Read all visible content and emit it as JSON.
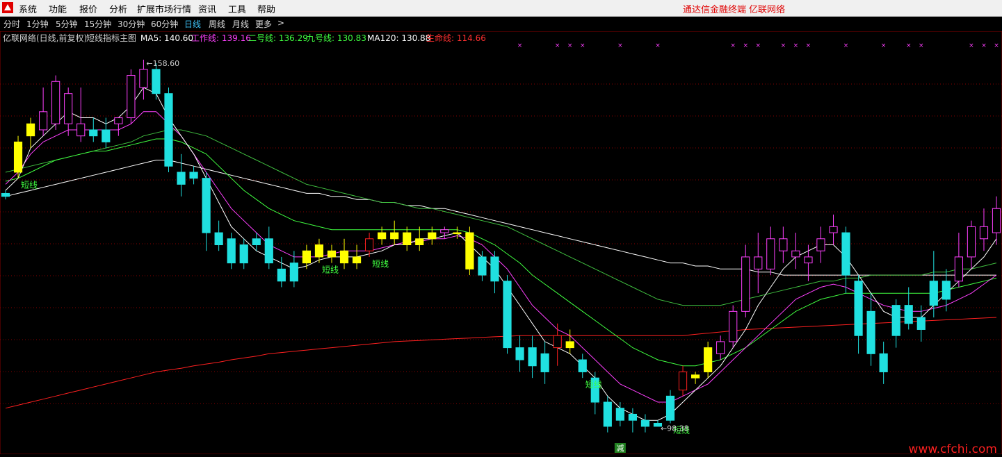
{
  "menu": {
    "items": [
      "系统",
      "功能",
      "报价",
      "分析",
      "扩展市场行情",
      "资讯",
      "工具",
      "帮助"
    ],
    "brand_left": "通达信金融终端",
    "brand_right": "亿联网络"
  },
  "periods": {
    "items": [
      "分时",
      "1分钟",
      "5分钟",
      "15分钟",
      "30分钟",
      "60分钟",
      "日线",
      "周线",
      "月线",
      "更多"
    ],
    "active": "日线",
    "more_arrow": ">"
  },
  "legend": {
    "prefix": "亿联网络(日线,前复权)",
    "indicator": "短线指标主图",
    "entries": [
      {
        "label": "MA5: 140.60",
        "color": "#ffffff"
      },
      {
        "label": "工作线: 139.16",
        "color": "#ff40ff"
      },
      {
        "label": "二号线: 136.29",
        "color": "#40ff40"
      },
      {
        "label": "九号线: 130.83",
        "color": "#40ff40"
      },
      {
        "label": "MA120: 130.88",
        "color": "#ffffff"
      },
      {
        "label": "生命线: 114.66",
        "color": "#ff3030"
      }
    ]
  },
  "colors": {
    "up": "#ff40ff",
    "down": "#20e0e0",
    "signal": "#ffff00",
    "signal_up": "#ff2020",
    "ma5": "#ffffff",
    "work": "#ff40ff",
    "line2": "#40ff40",
    "line9": "#40c040",
    "ma120": "#ffffff",
    "life": "#ff2020",
    "grid": "#8a0000",
    "label_green": "#40ff40",
    "extreme_label": "#d0d0d0",
    "marker": "#ff40ff",
    "jian_bg": "#208020",
    "jian_text": "#ffffff"
  },
  "chart_data": {
    "type": "candlestick",
    "y_range": [
      95,
      161
    ],
    "extremes": {
      "high": {
        "value": 158.6,
        "label": "158.60",
        "index": 11
      },
      "low": {
        "value": 98.38,
        "label": "98.38",
        "index": 52
      }
    },
    "signal_label": "短线",
    "signal_label_indices": [
      1,
      25,
      29,
      46,
      53
    ],
    "jian_label": "减",
    "jian_index": 49,
    "candles": [
      {
        "o": 136,
        "h": 137,
        "l": 135.5,
        "c": 136.5,
        "k": "d"
      },
      {
        "o": 140,
        "h": 146,
        "l": 139,
        "c": 145,
        "k": "s"
      },
      {
        "o": 146,
        "h": 149,
        "l": 144,
        "c": 148,
        "k": "s"
      },
      {
        "o": 150,
        "h": 154,
        "l": 146,
        "c": 147,
        "k": "u"
      },
      {
        "o": 148,
        "h": 156,
        "l": 147,
        "c": 155,
        "k": "u"
      },
      {
        "o": 153,
        "h": 154,
        "l": 146,
        "c": 148,
        "k": "u"
      },
      {
        "o": 148,
        "h": 154,
        "l": 145,
        "c": 146,
        "k": "u"
      },
      {
        "o": 147,
        "h": 149,
        "l": 145,
        "c": 146,
        "k": "d"
      },
      {
        "o": 145,
        "h": 149,
        "l": 144,
        "c": 147,
        "k": "d"
      },
      {
        "o": 148,
        "h": 149,
        "l": 146,
        "c": 149,
        "k": "u"
      },
      {
        "o": 149,
        "h": 157,
        "l": 148,
        "c": 156,
        "k": "u"
      },
      {
        "o": 154,
        "h": 158.6,
        "l": 152,
        "c": 157,
        "k": "u"
      },
      {
        "o": 157,
        "h": 158,
        "l": 152,
        "c": 153,
        "k": "d"
      },
      {
        "o": 153,
        "h": 154,
        "l": 140,
        "c": 141,
        "k": "d"
      },
      {
        "o": 140,
        "h": 143,
        "l": 136,
        "c": 138,
        "k": "d"
      },
      {
        "o": 140,
        "h": 141,
        "l": 138,
        "c": 139,
        "k": "d"
      },
      {
        "o": 139,
        "h": 140,
        "l": 127,
        "c": 130,
        "k": "d"
      },
      {
        "o": 130,
        "h": 132,
        "l": 127,
        "c": 128,
        "k": "d"
      },
      {
        "o": 129,
        "h": 130,
        "l": 124,
        "c": 125,
        "k": "d"
      },
      {
        "o": 125,
        "h": 129,
        "l": 124,
        "c": 128,
        "k": "d"
      },
      {
        "o": 128,
        "h": 130,
        "l": 127,
        "c": 129,
        "k": "d"
      },
      {
        "o": 129,
        "h": 131,
        "l": 124,
        "c": 125,
        "k": "d"
      },
      {
        "o": 124,
        "h": 126,
        "l": 121,
        "c": 122,
        "k": "d"
      },
      {
        "o": 122,
        "h": 127,
        "l": 121,
        "c": 125,
        "k": "d"
      },
      {
        "o": 125,
        "h": 128,
        "l": 124,
        "c": 127,
        "k": "s"
      },
      {
        "o": 128,
        "h": 129,
        "l": 125,
        "c": 126,
        "k": "s"
      },
      {
        "o": 127,
        "h": 128,
        "l": 125,
        "c": 126,
        "k": "s"
      },
      {
        "o": 127,
        "h": 129,
        "l": 124,
        "c": 125,
        "k": "s"
      },
      {
        "o": 125,
        "h": 128,
        "l": 124,
        "c": 126,
        "k": "s"
      },
      {
        "o": 129,
        "h": 130,
        "l": 126,
        "c": 127,
        "k": "r"
      },
      {
        "o": 129,
        "h": 131,
        "l": 128,
        "c": 130,
        "k": "s"
      },
      {
        "o": 130,
        "h": 132,
        "l": 128,
        "c": 129,
        "k": "s"
      },
      {
        "o": 130,
        "h": 131,
        "l": 127,
        "c": 128,
        "k": "s"
      },
      {
        "o": 129,
        "h": 131,
        "l": 127,
        "c": 128,
        "k": "s"
      },
      {
        "o": 130,
        "h": 131,
        "l": 128,
        "c": 129,
        "k": "s"
      },
      {
        "o": 130,
        "h": 131,
        "l": 129,
        "c": 130.5,
        "k": "u"
      },
      {
        "o": 130,
        "h": 131,
        "l": 129,
        "c": 130,
        "k": "s"
      },
      {
        "o": 130,
        "h": 131,
        "l": 123,
        "c": 124,
        "k": "s"
      },
      {
        "o": 126,
        "h": 127,
        "l": 122,
        "c": 123,
        "k": "d"
      },
      {
        "o": 126,
        "h": 127,
        "l": 120,
        "c": 122,
        "k": "d"
      },
      {
        "o": 122,
        "h": 123,
        "l": 110,
        "c": 111,
        "k": "d"
      },
      {
        "o": 111,
        "h": 113,
        "l": 107,
        "c": 109,
        "k": "d"
      },
      {
        "o": 111,
        "h": 113,
        "l": 106,
        "c": 108,
        "k": "d"
      },
      {
        "o": 110,
        "h": 112,
        "l": 105,
        "c": 107,
        "k": "d"
      },
      {
        "o": 111,
        "h": 115,
        "l": 108,
        "c": 113,
        "k": "r"
      },
      {
        "o": 111,
        "h": 114,
        "l": 110,
        "c": 112,
        "k": "s"
      },
      {
        "o": 109,
        "h": 110,
        "l": 106,
        "c": 107,
        "k": "d"
      },
      {
        "o": 106,
        "h": 107,
        "l": 100,
        "c": 102,
        "k": "d"
      },
      {
        "o": 102,
        "h": 103,
        "l": 97,
        "c": 98,
        "k": "d"
      },
      {
        "o": 101,
        "h": 102,
        "l": 98,
        "c": 99,
        "k": "d"
      },
      {
        "o": 100,
        "h": 101,
        "l": 97,
        "c": 99,
        "k": "d"
      },
      {
        "o": 99,
        "h": 100,
        "l": 97,
        "c": 98,
        "k": "d"
      },
      {
        "o": 98,
        "h": 99,
        "l": 98.38,
        "c": 98.5,
        "k": "d"
      },
      {
        "o": 99,
        "h": 104,
        "l": 98.5,
        "c": 103,
        "k": "d"
      },
      {
        "o": 104,
        "h": 108,
        "l": 103,
        "c": 107,
        "k": "r"
      },
      {
        "o": 106,
        "h": 107,
        "l": 105,
        "c": 106.5,
        "k": "s"
      },
      {
        "o": 107,
        "h": 112,
        "l": 106,
        "c": 111,
        "k": "s"
      },
      {
        "o": 110,
        "h": 113,
        "l": 109,
        "c": 112,
        "k": "u"
      },
      {
        "o": 112,
        "h": 118,
        "l": 111,
        "c": 117,
        "k": "u"
      },
      {
        "o": 117,
        "h": 128,
        "l": 116,
        "c": 126,
        "k": "u"
      },
      {
        "o": 126,
        "h": 130,
        "l": 120,
        "c": 124,
        "k": "u"
      },
      {
        "o": 124,
        "h": 131,
        "l": 123,
        "c": 129,
        "k": "u"
      },
      {
        "o": 129,
        "h": 131,
        "l": 125,
        "c": 127,
        "k": "u"
      },
      {
        "o": 127,
        "h": 130,
        "l": 124,
        "c": 126,
        "k": "u"
      },
      {
        "o": 126,
        "h": 128,
        "l": 122,
        "c": 125,
        "k": "u"
      },
      {
        "o": 127,
        "h": 131,
        "l": 125,
        "c": 129,
        "k": "u"
      },
      {
        "o": 130,
        "h": 133,
        "l": 128,
        "c": 131,
        "k": "u"
      },
      {
        "o": 130,
        "h": 131,
        "l": 120,
        "c": 123,
        "k": "d"
      },
      {
        "o": 122,
        "h": 123,
        "l": 110,
        "c": 113,
        "k": "d"
      },
      {
        "o": 117,
        "h": 120,
        "l": 108,
        "c": 110,
        "k": "d"
      },
      {
        "o": 110,
        "h": 112,
        "l": 105,
        "c": 107,
        "k": "d"
      },
      {
        "o": 113,
        "h": 119,
        "l": 111,
        "c": 118,
        "k": "d"
      },
      {
        "o": 118,
        "h": 121,
        "l": 114,
        "c": 115,
        "k": "d"
      },
      {
        "o": 116,
        "h": 118,
        "l": 112,
        "c": 114,
        "k": "d"
      },
      {
        "o": 118,
        "h": 127,
        "l": 116,
        "c": 122,
        "k": "d"
      },
      {
        "o": 122,
        "h": 124,
        "l": 117,
        "c": 119,
        "k": "d"
      },
      {
        "o": 122,
        "h": 130,
        "l": 121,
        "c": 126,
        "k": "u"
      },
      {
        "o": 126,
        "h": 132,
        "l": 124,
        "c": 131,
        "k": "u"
      },
      {
        "o": 131,
        "h": 134,
        "l": 127,
        "c": 129,
        "k": "u"
      },
      {
        "o": 130,
        "h": 136,
        "l": 128,
        "c": 134,
        "k": "u"
      }
    ],
    "lines": {
      "ma5": [
        137,
        139,
        144,
        146,
        148,
        150,
        149,
        149,
        148,
        149,
        151,
        154,
        153,
        149,
        146,
        143,
        139,
        135,
        131,
        129,
        127,
        126,
        125,
        124,
        124.5,
        125.5,
        126,
        126,
        126,
        126.5,
        127,
        128,
        128,
        129,
        129,
        129.5,
        130,
        128,
        126,
        124,
        121,
        118,
        115,
        112,
        111,
        110,
        108,
        106,
        103,
        101,
        100,
        99,
        99,
        100,
        102,
        104,
        106,
        108,
        111,
        114,
        118,
        121,
        124,
        126,
        127,
        128,
        128,
        126,
        123,
        120,
        117,
        116,
        116,
        116,
        118,
        120,
        122,
        124,
        126,
        129
      ],
      "work": [
        138,
        140,
        143,
        145,
        146,
        147,
        147,
        147,
        147,
        147,
        148,
        150,
        150,
        148,
        146,
        143,
        140,
        137,
        134,
        132,
        130,
        128,
        127,
        126,
        126,
        126,
        126.5,
        127,
        127,
        127,
        127.5,
        128,
        128.5,
        128.5,
        129,
        129,
        129.5,
        129,
        128,
        126,
        124,
        121,
        118,
        116,
        114,
        113,
        111,
        109,
        107,
        105,
        104,
        103,
        102,
        102,
        103,
        104,
        105,
        107,
        109,
        111,
        113,
        115,
        117,
        119,
        120,
        121,
        121.5,
        121,
        120,
        119,
        118,
        117.5,
        117,
        117,
        117.5,
        118,
        119,
        120,
        121.5,
        123
      ],
      "line2": [
        138.5,
        139,
        140,
        141,
        142,
        142.5,
        143,
        143.5,
        143.5,
        144,
        144.5,
        145,
        145.5,
        145.5,
        145,
        144,
        143,
        141,
        139,
        137,
        135.5,
        134,
        133,
        132,
        131.5,
        131,
        130.5,
        130.5,
        130.5,
        130.5,
        130.5,
        130.5,
        130.5,
        130.5,
        130.5,
        130.5,
        130.5,
        130,
        129,
        128,
        126.5,
        125,
        123,
        121.5,
        120,
        118.5,
        117,
        115.5,
        114,
        112.5,
        111,
        110,
        109,
        108.5,
        108,
        108,
        108.5,
        109,
        110,
        111,
        112.5,
        114,
        115.5,
        117,
        118,
        119,
        119.5,
        120,
        120,
        120,
        120,
        120,
        120,
        120,
        120,
        120.5,
        121,
        121.5,
        122,
        122.5
      ],
      "line9": [
        140,
        140.5,
        141,
        141.5,
        142,
        142.5,
        143,
        143.5,
        144,
        144.5,
        145,
        146,
        146.5,
        147,
        147,
        146.5,
        146,
        145,
        144,
        143,
        142,
        141,
        140,
        139,
        138,
        137.5,
        137,
        136.5,
        136,
        135.5,
        135,
        135,
        134.5,
        134,
        134,
        133.5,
        133,
        132.5,
        132,
        131.5,
        131,
        130,
        129,
        128,
        127,
        126,
        125,
        124,
        123,
        122,
        121,
        120,
        119,
        118.5,
        118,
        118,
        118,
        118,
        118.5,
        119,
        119.5,
        120,
        120.5,
        121,
        121.5,
        122,
        122,
        122.5,
        122.5,
        123,
        123,
        123,
        123,
        123,
        123.5,
        123.5,
        124,
        124,
        124.5,
        125
      ],
      "ma120": [
        136,
        136.5,
        137,
        137.5,
        138,
        138.5,
        139,
        139.5,
        140,
        140.5,
        141,
        141.5,
        142,
        142,
        141.5,
        141,
        140.5,
        140,
        139.5,
        139,
        138.5,
        138,
        137.5,
        137,
        136.5,
        136.5,
        136,
        136,
        135.5,
        135.5,
        135,
        135,
        134.5,
        134.5,
        134,
        134,
        133.5,
        133,
        132.5,
        132,
        131.5,
        131,
        130.5,
        130,
        129.5,
        129,
        128.5,
        128,
        127.5,
        127,
        126.5,
        126,
        125.5,
        125,
        125,
        124.5,
        124.5,
        124,
        124,
        124,
        123.5,
        123.5,
        123,
        123,
        123,
        123,
        123,
        123,
        123,
        123,
        123,
        123,
        123,
        123,
        123,
        123,
        123,
        123,
        123,
        123
      ],
      "life": [
        101,
        101.5,
        102,
        102.5,
        103,
        103.5,
        104,
        104.5,
        105,
        105.5,
        106,
        106.5,
        107,
        107.3,
        107.6,
        108,
        108.3,
        108.6,
        109,
        109.3,
        109.6,
        110,
        110.2,
        110.4,
        110.6,
        110.8,
        111,
        111.2,
        111.4,
        111.6,
        111.8,
        112,
        112.1,
        112.2,
        112.3,
        112.4,
        112.5,
        112.6,
        112.7,
        112.8,
        112.9,
        113,
        113,
        113,
        113,
        113,
        113,
        113,
        113,
        113,
        113,
        113,
        113,
        113,
        113,
        113.2,
        113.4,
        113.6,
        113.8,
        114,
        114.1,
        114.2,
        114.3,
        114.4,
        114.5,
        114.6,
        114.7,
        114.8,
        114.9,
        115,
        115.1,
        115.2,
        115.3,
        115.4,
        115.5,
        115.6,
        115.7,
        115.8,
        115.9,
        116
      ]
    },
    "top_marker": "×",
    "top_marker_indices": [
      41,
      44,
      45,
      46,
      49,
      52,
      58,
      59,
      60,
      62,
      63,
      64,
      67,
      70,
      72,
      73,
      77,
      78,
      79
    ]
  },
  "watermark": "www.cfchi.com"
}
